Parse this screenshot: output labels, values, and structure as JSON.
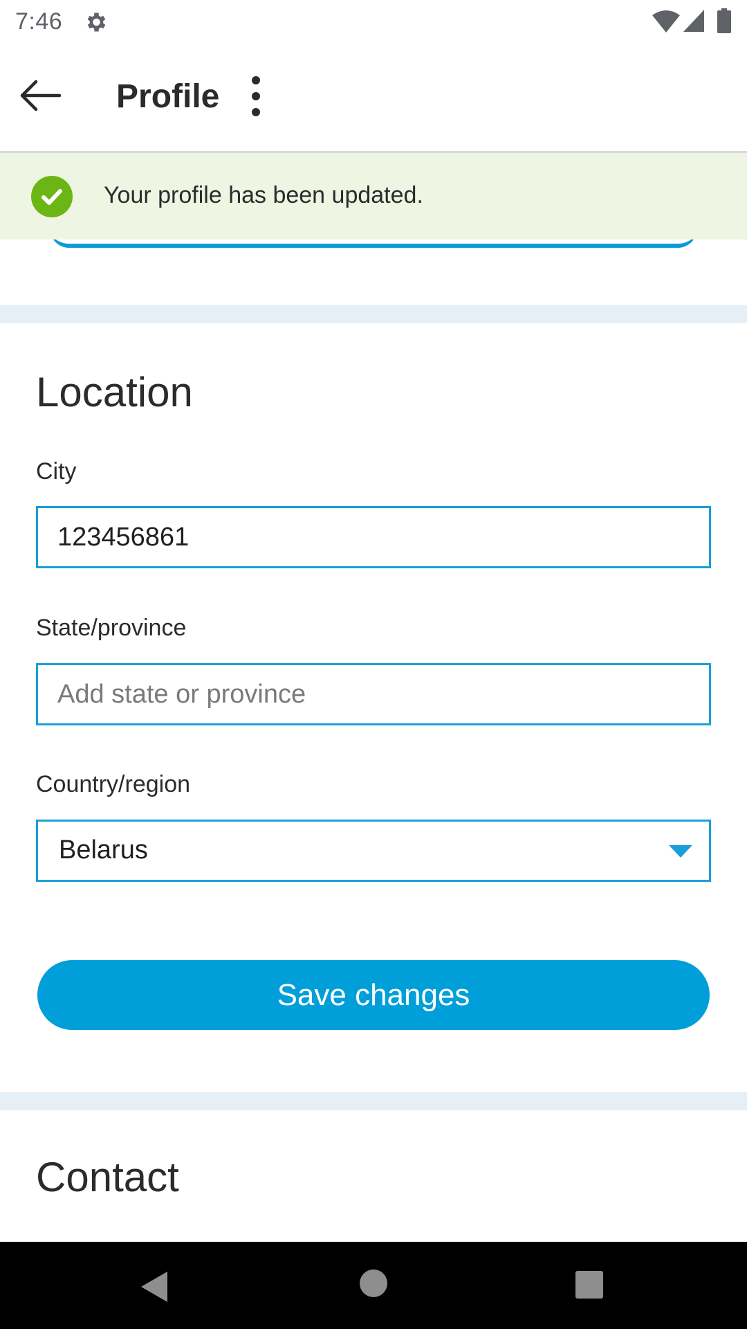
{
  "status_bar": {
    "time": "7:46",
    "icons": [
      "gear-icon",
      "wifi-icon",
      "signal-icon",
      "battery-icon"
    ]
  },
  "app_bar": {
    "title": "Profile",
    "back_icon": "arrow-left-icon",
    "menu_icon": "more-vertical-icon"
  },
  "banner": {
    "message": "Your profile has been updated.",
    "icon": "check-circle-icon",
    "background_color": "#eef5e3",
    "icon_color": "#6bb514"
  },
  "location": {
    "title": "Location",
    "city": {
      "label": "City",
      "value": "123456861"
    },
    "state": {
      "label": "State/province",
      "value": "",
      "placeholder": "Add state or province"
    },
    "country": {
      "label": "Country/region",
      "value": "Belarus",
      "icon": "caret-down-icon"
    },
    "save_label": "Save changes"
  },
  "contact": {
    "title": "Contact"
  },
  "nav_bar": {
    "icons": [
      "nav-back-icon",
      "nav-home-icon",
      "nav-recents-icon"
    ]
  },
  "colors": {
    "accent": "#019fd9",
    "field_border": "#1a9fd8",
    "divider": "#e6eff5"
  }
}
